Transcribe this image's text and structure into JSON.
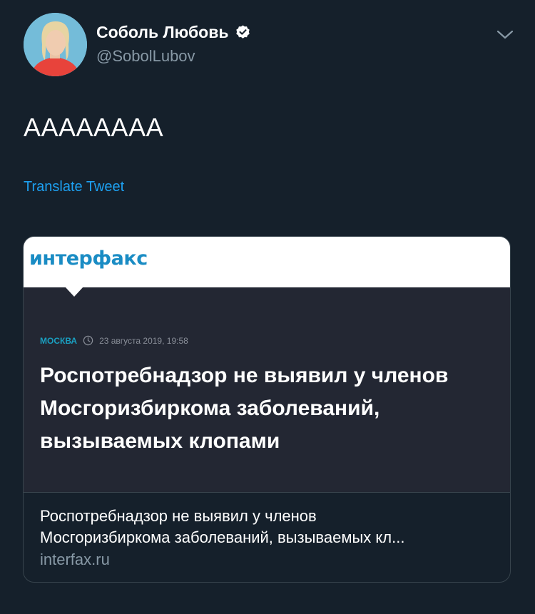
{
  "author": {
    "display_name": "Соболь Любовь",
    "handle": "@SobolLubov",
    "verified_icon": "verified-badge-icon",
    "avatar_icon": "avatar-photo"
  },
  "tweet": {
    "text": "АААААААА",
    "translate_label": "Translate Tweet"
  },
  "card": {
    "image": {
      "logo_text": "интерфакс",
      "city": "МОСКВА",
      "date": "23 августа 2019, 19:58",
      "headline": "Роспотребнадзор не выявил у членов Мосгоризбиркома заболеваний, вызываемых клопами"
    },
    "title_line1": "Роспотребнадзор не выявил у членов",
    "title_line2": "Мосгоризбиркома заболеваний, вызываемых кл...",
    "domain": "interfax.ru"
  },
  "colors": {
    "background": "#15202b",
    "link": "#1da1f2",
    "secondary_text": "#8899a6",
    "border": "#38444d",
    "interfax_blue": "#1a8cc4"
  }
}
